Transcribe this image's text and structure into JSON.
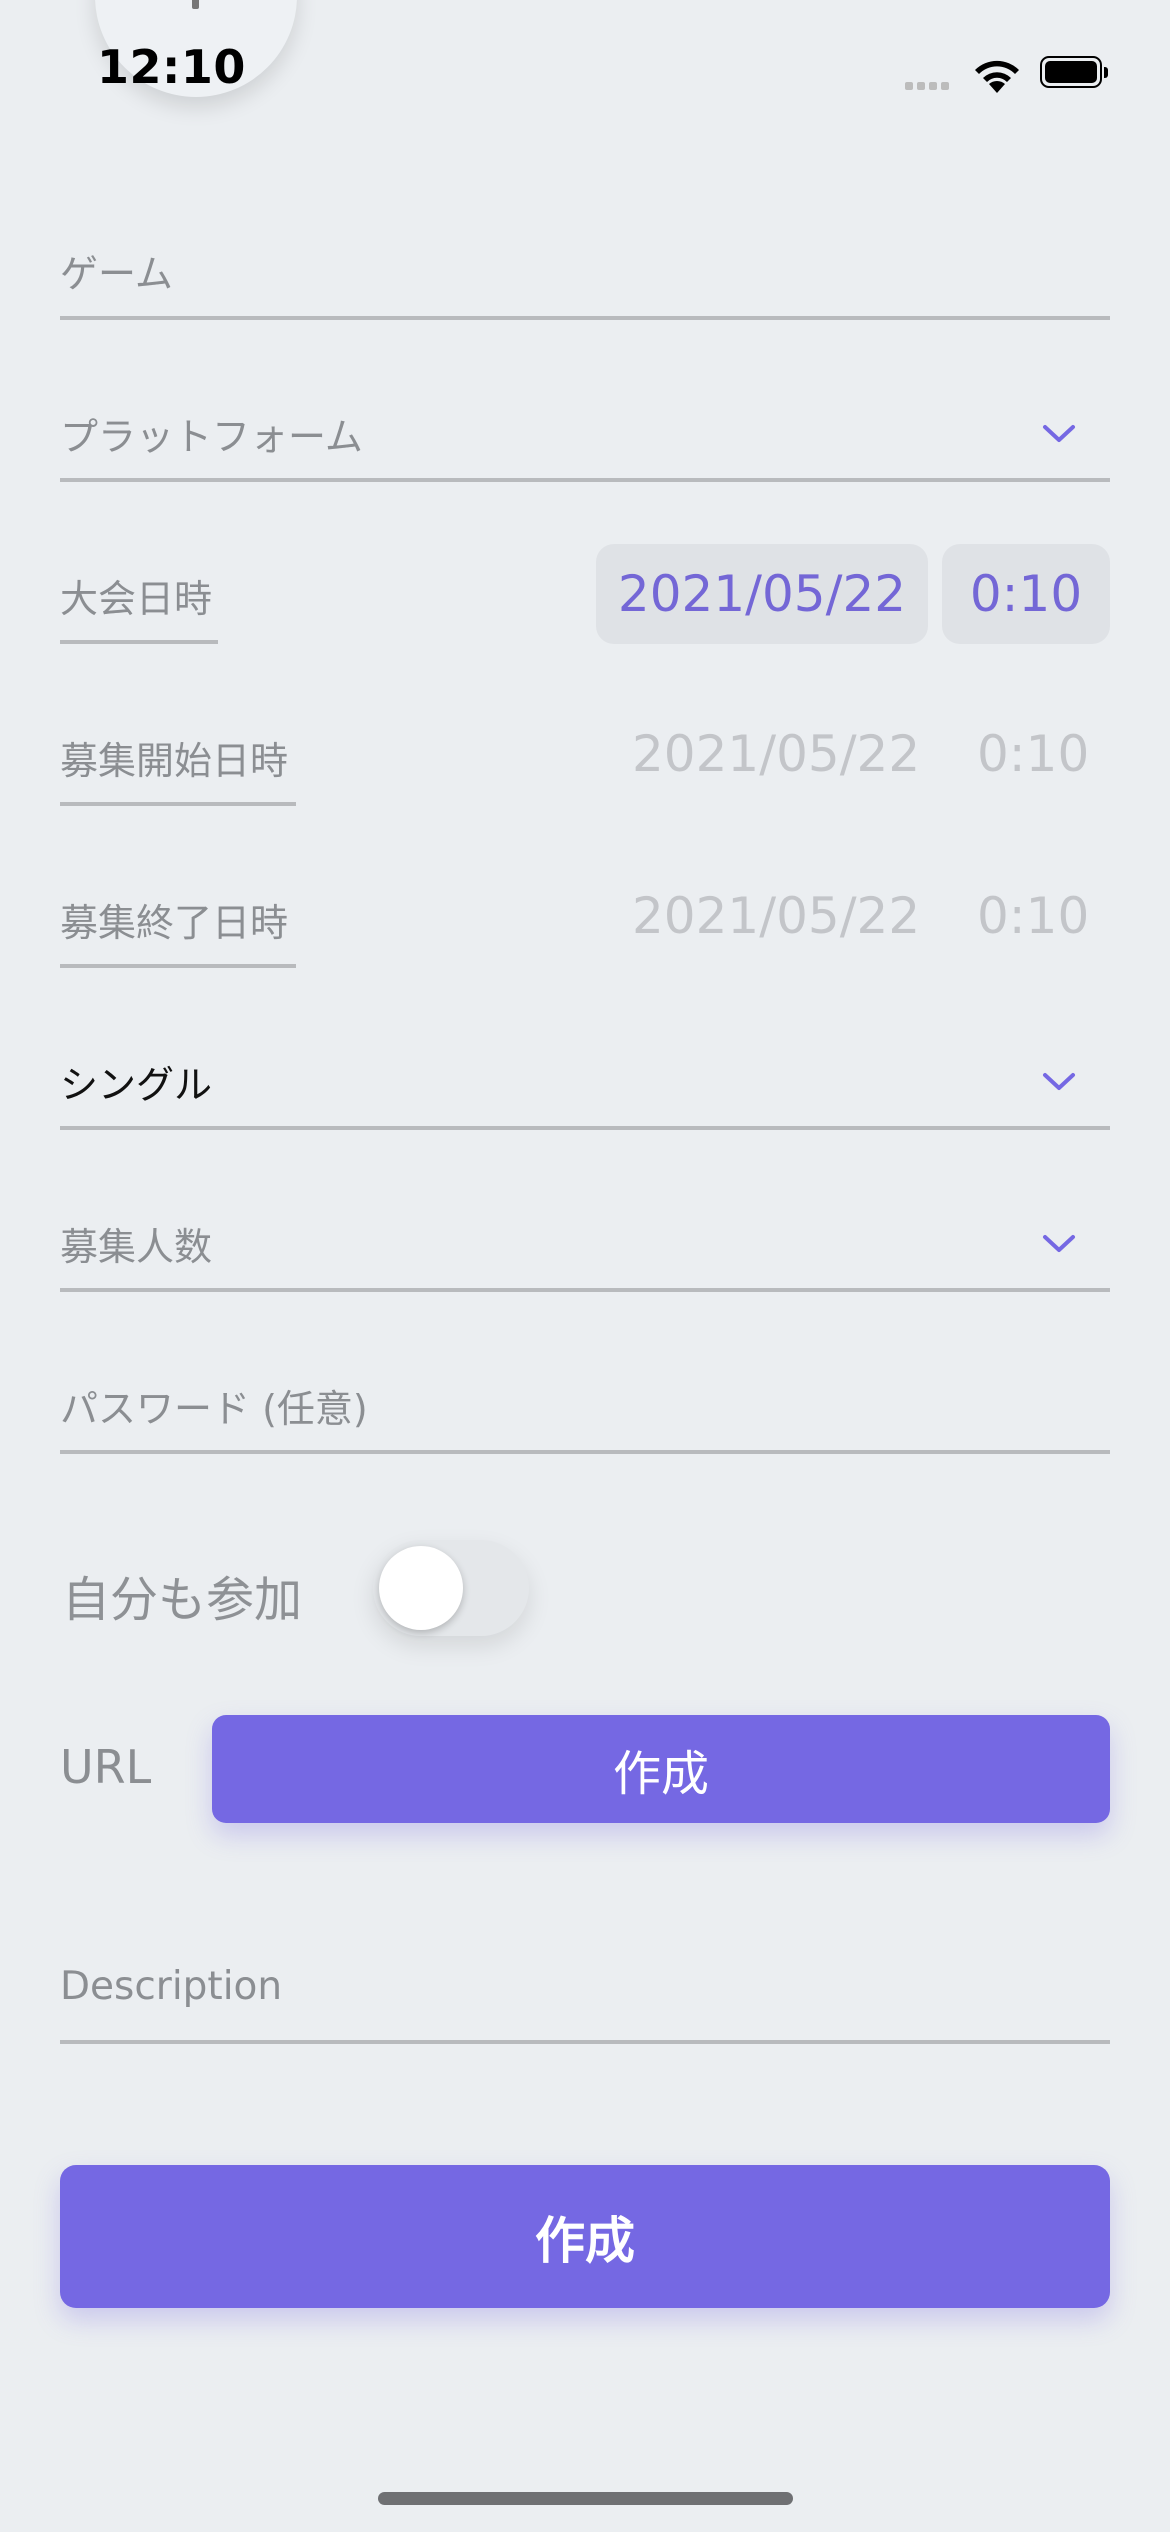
{
  "status_bar": {
    "time": "12:10"
  },
  "form": {
    "game": {
      "placeholder": "ゲーム"
    },
    "platform": {
      "placeholder": "プラットフォーム"
    },
    "event_datetime": {
      "label": "大会日時",
      "date": "2021/05/22",
      "time": "0:10"
    },
    "recruit_start": {
      "label": "募集開始日時",
      "date": "2021/05/22",
      "time": "0:10"
    },
    "recruit_end": {
      "label": "募集終了日時",
      "date": "2021/05/22",
      "time": "0:10"
    },
    "format": {
      "value": "シングル"
    },
    "capacity": {
      "placeholder": "募集人数"
    },
    "password": {
      "placeholder": "パスワード (任意)"
    },
    "join_self": {
      "label": "自分も参加",
      "enabled": false
    },
    "url": {
      "label": "URL",
      "button_label": "作成"
    },
    "description": {
      "placeholder": "Description"
    },
    "submit": {
      "label": "作成"
    }
  },
  "colors": {
    "accent": "#7568e3",
    "background": "#ebeef1",
    "placeholder": "#8b8e92",
    "disabled_text": "#c3c5c9"
  }
}
